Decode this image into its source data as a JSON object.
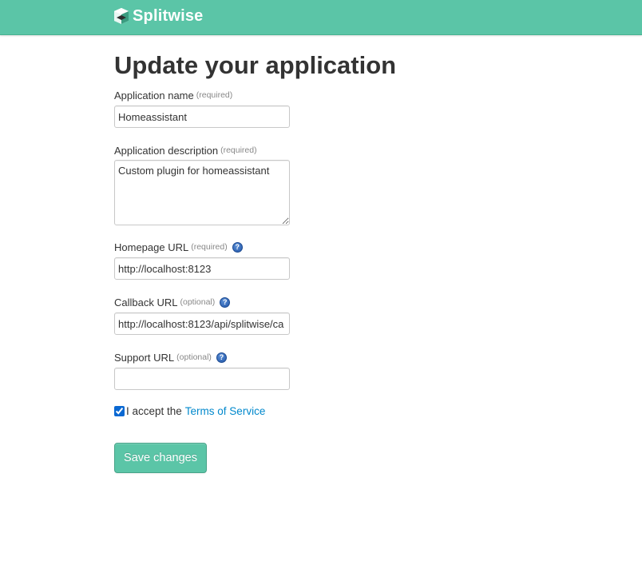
{
  "header": {
    "brand": "Splitwise",
    "logo_icon": "splitwise-logo-icon",
    "bar_color": "#5bc5a7"
  },
  "page": {
    "title": "Update your application"
  },
  "form": {
    "app_name": {
      "label": "Application name",
      "requirement": "(required)",
      "value": "Homeassistant"
    },
    "app_description": {
      "label": "Application description",
      "requirement": "(required)",
      "value": "Custom plugin for homeassistant"
    },
    "homepage_url": {
      "label": "Homepage URL",
      "requirement": "(required)",
      "help_icon": "question-help-icon",
      "value": "http://localhost:8123"
    },
    "callback_url": {
      "label": "Callback URL",
      "requirement": "(optional)",
      "help_icon": "question-help-icon",
      "value": "http://localhost:8123/api/splitwise/ca"
    },
    "support_url": {
      "label": "Support URL",
      "requirement": "(optional)",
      "help_icon": "question-help-icon",
      "value": ""
    },
    "terms": {
      "checked": true,
      "prefix": "I accept the",
      "link_text": "Terms of Service",
      "link_color": "#0088cc"
    },
    "submit_label": "Save changes",
    "submit_color": "#5bc5a7"
  }
}
